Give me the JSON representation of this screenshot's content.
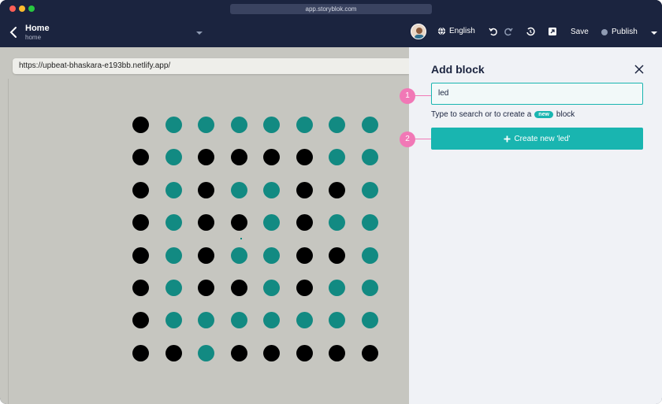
{
  "window": {
    "address": "app.storyblok.com"
  },
  "toolbar": {
    "title": "Home",
    "subtitle": "home",
    "language": "English",
    "save_label": "Save",
    "publish_label": "Publish"
  },
  "preview": {
    "url": "https://upbeat-bhaskara-e193bb.netlify.app/",
    "led_matrix": [
      [
        0,
        1,
        1,
        1,
        1,
        1,
        1,
        1
      ],
      [
        0,
        1,
        0,
        0,
        0,
        0,
        1,
        1
      ],
      [
        0,
        1,
        0,
        1,
        1,
        0,
        0,
        1
      ],
      [
        0,
        1,
        0,
        0,
        1,
        0,
        1,
        1
      ],
      [
        0,
        1,
        0,
        1,
        1,
        0,
        0,
        1
      ],
      [
        0,
        1,
        0,
        0,
        1,
        0,
        1,
        1
      ],
      [
        0,
        1,
        1,
        1,
        1,
        1,
        1,
        1
      ],
      [
        0,
        0,
        1,
        0,
        0,
        0,
        0,
        0
      ]
    ],
    "colors": {
      "on": "#128a82",
      "off": "#000000"
    }
  },
  "panel": {
    "title": "Add block",
    "search_value": "led",
    "hint_before": "Type to search or to create a",
    "hint_badge": "new",
    "hint_after": "block",
    "create_label": "Create new 'led'"
  },
  "callouts": {
    "one": "1",
    "two": "2"
  },
  "colors": {
    "accent": "#19b5b0",
    "header": "#1b243f",
    "callout": "#f178b6"
  }
}
